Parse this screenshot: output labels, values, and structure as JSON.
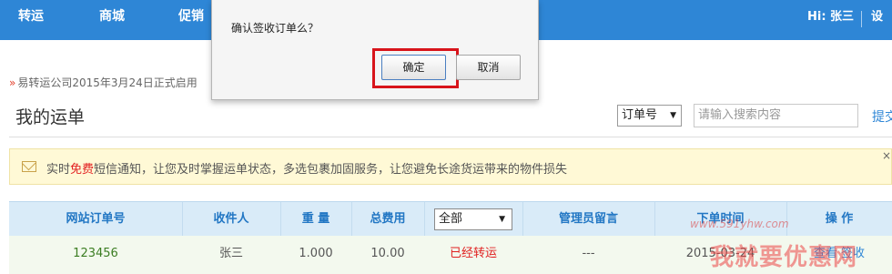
{
  "nav": {
    "items": [
      "转运",
      "商城",
      "促销"
    ],
    "user_greeting": "Hi: 张三",
    "settings_label": "设置"
  },
  "notice": "易转运公司2015年3月24日正式启用",
  "page_title": "我的运单",
  "search": {
    "field_value": "订单号",
    "placeholder": "请输入搜索内容",
    "submit_label": "提交"
  },
  "banner": {
    "text_before": "实时",
    "text_highlight": "免费",
    "text_after": "短信通知，让您及时掌握运单状态，多选包裹加固服务，让您避免长途货运带来的物件损失",
    "close_label": "×"
  },
  "table": {
    "headers": {
      "order_no": "网站订单号",
      "recipient": "收件人",
      "weight": "重 量",
      "total_fee": "总费用",
      "admin_msg": "管理员留言",
      "order_time": "下单时间",
      "action": "操 作"
    },
    "status_filter": "全部",
    "rows": [
      {
        "order_no": "123456",
        "recipient": "张三",
        "weight": "1.000",
        "total_fee": "10.00",
        "status": "已经转运",
        "admin_msg": "---",
        "order_time": "2015-03-24",
        "action": "查看 签收"
      }
    ]
  },
  "dialog": {
    "message": "确认签收订单么？",
    "ok_label": "确定",
    "cancel_label": "取消"
  },
  "watermark": {
    "url": "www.591yhw.com",
    "text": "我就要优惠网"
  },
  "colors": {
    "nav_bg": "#2e86d6",
    "highlight": "#d8141b",
    "status": "#e02020",
    "header_text": "#2277c4"
  }
}
